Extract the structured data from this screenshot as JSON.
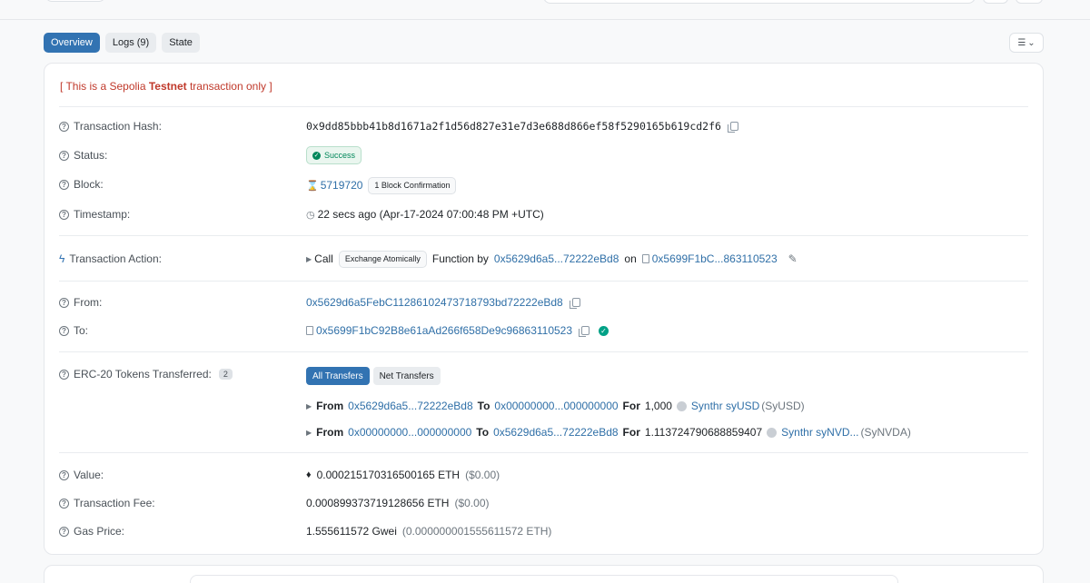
{
  "tabs": [
    {
      "label": "Overview"
    },
    {
      "label": "Logs (9)"
    },
    {
      "label": "State"
    }
  ],
  "notice": {
    "prefix": "[ This is a Sepolia ",
    "bold": "Testnet",
    "suffix": " transaction only ]"
  },
  "rows": {
    "tx_hash": {
      "label": "Transaction Hash:",
      "value": "0x9dd85bbb41b8d1671a2f1d56d827e31e7d3e688d866ef58f5290165b619cd2f6"
    },
    "status": {
      "label": "Status:",
      "value": "Success"
    },
    "block": {
      "label": "Block:",
      "value": "5719720",
      "confirmations": "1 Block Confirmation"
    },
    "timestamp": {
      "label": "Timestamp:",
      "value": "22 secs ago (Apr-17-2024 07:00:48 PM +UTC)"
    },
    "action": {
      "label": "Transaction Action:",
      "call": "Call",
      "method": "Exchange Atomically",
      "function_by": "Function by",
      "by_address": "0x5629d6a5...72222eBd8",
      "on": "on",
      "contract": "0x5699F1bC...863110523"
    },
    "from": {
      "label": "From:",
      "value": "0x5629d6a5FebC11286102473718793bd72222eBd8"
    },
    "to": {
      "label": "To:",
      "value": "0x5699F1bC92B8e61aAd266f658De9c96863110523"
    },
    "erc20": {
      "label": "ERC-20 Tokens Transferred:",
      "count": "2",
      "buttons": [
        "All Transfers",
        "Net Transfers"
      ],
      "transfers": [
        {
          "from_label": "From",
          "from": "0x5629d6a5...72222eBd8",
          "to_label": "To",
          "to": "0x00000000...000000000",
          "for_label": "For",
          "amount": "1,000",
          "token": "Synthr syUSD",
          "symbol": "(SyUSD)"
        },
        {
          "from_label": "From",
          "from": "0x00000000...000000000",
          "to_label": "To",
          "to": "0x5629d6a5...72222eBd8",
          "for_label": "For",
          "amount": "1.113724790688859407",
          "token": "Synthr syNVD...",
          "symbol": "(SyNVDA)"
        }
      ]
    },
    "value": {
      "label": "Value:",
      "amount": "0.000215170316500165 ETH",
      "usd": "($0.00)"
    },
    "fee": {
      "label": "Transaction Fee:",
      "amount": "0.000899373719128656 ETH",
      "usd": "($0.00)"
    },
    "gas": {
      "label": "Gas Price:",
      "amount": "1.555611572 Gwei",
      "eth": "(0.000000001555611572 ETH)"
    }
  },
  "colors": {
    "accent": "#3273b2",
    "link": "#2f6fa7",
    "success": "#00875a",
    "testnet": "#c0392b"
  }
}
